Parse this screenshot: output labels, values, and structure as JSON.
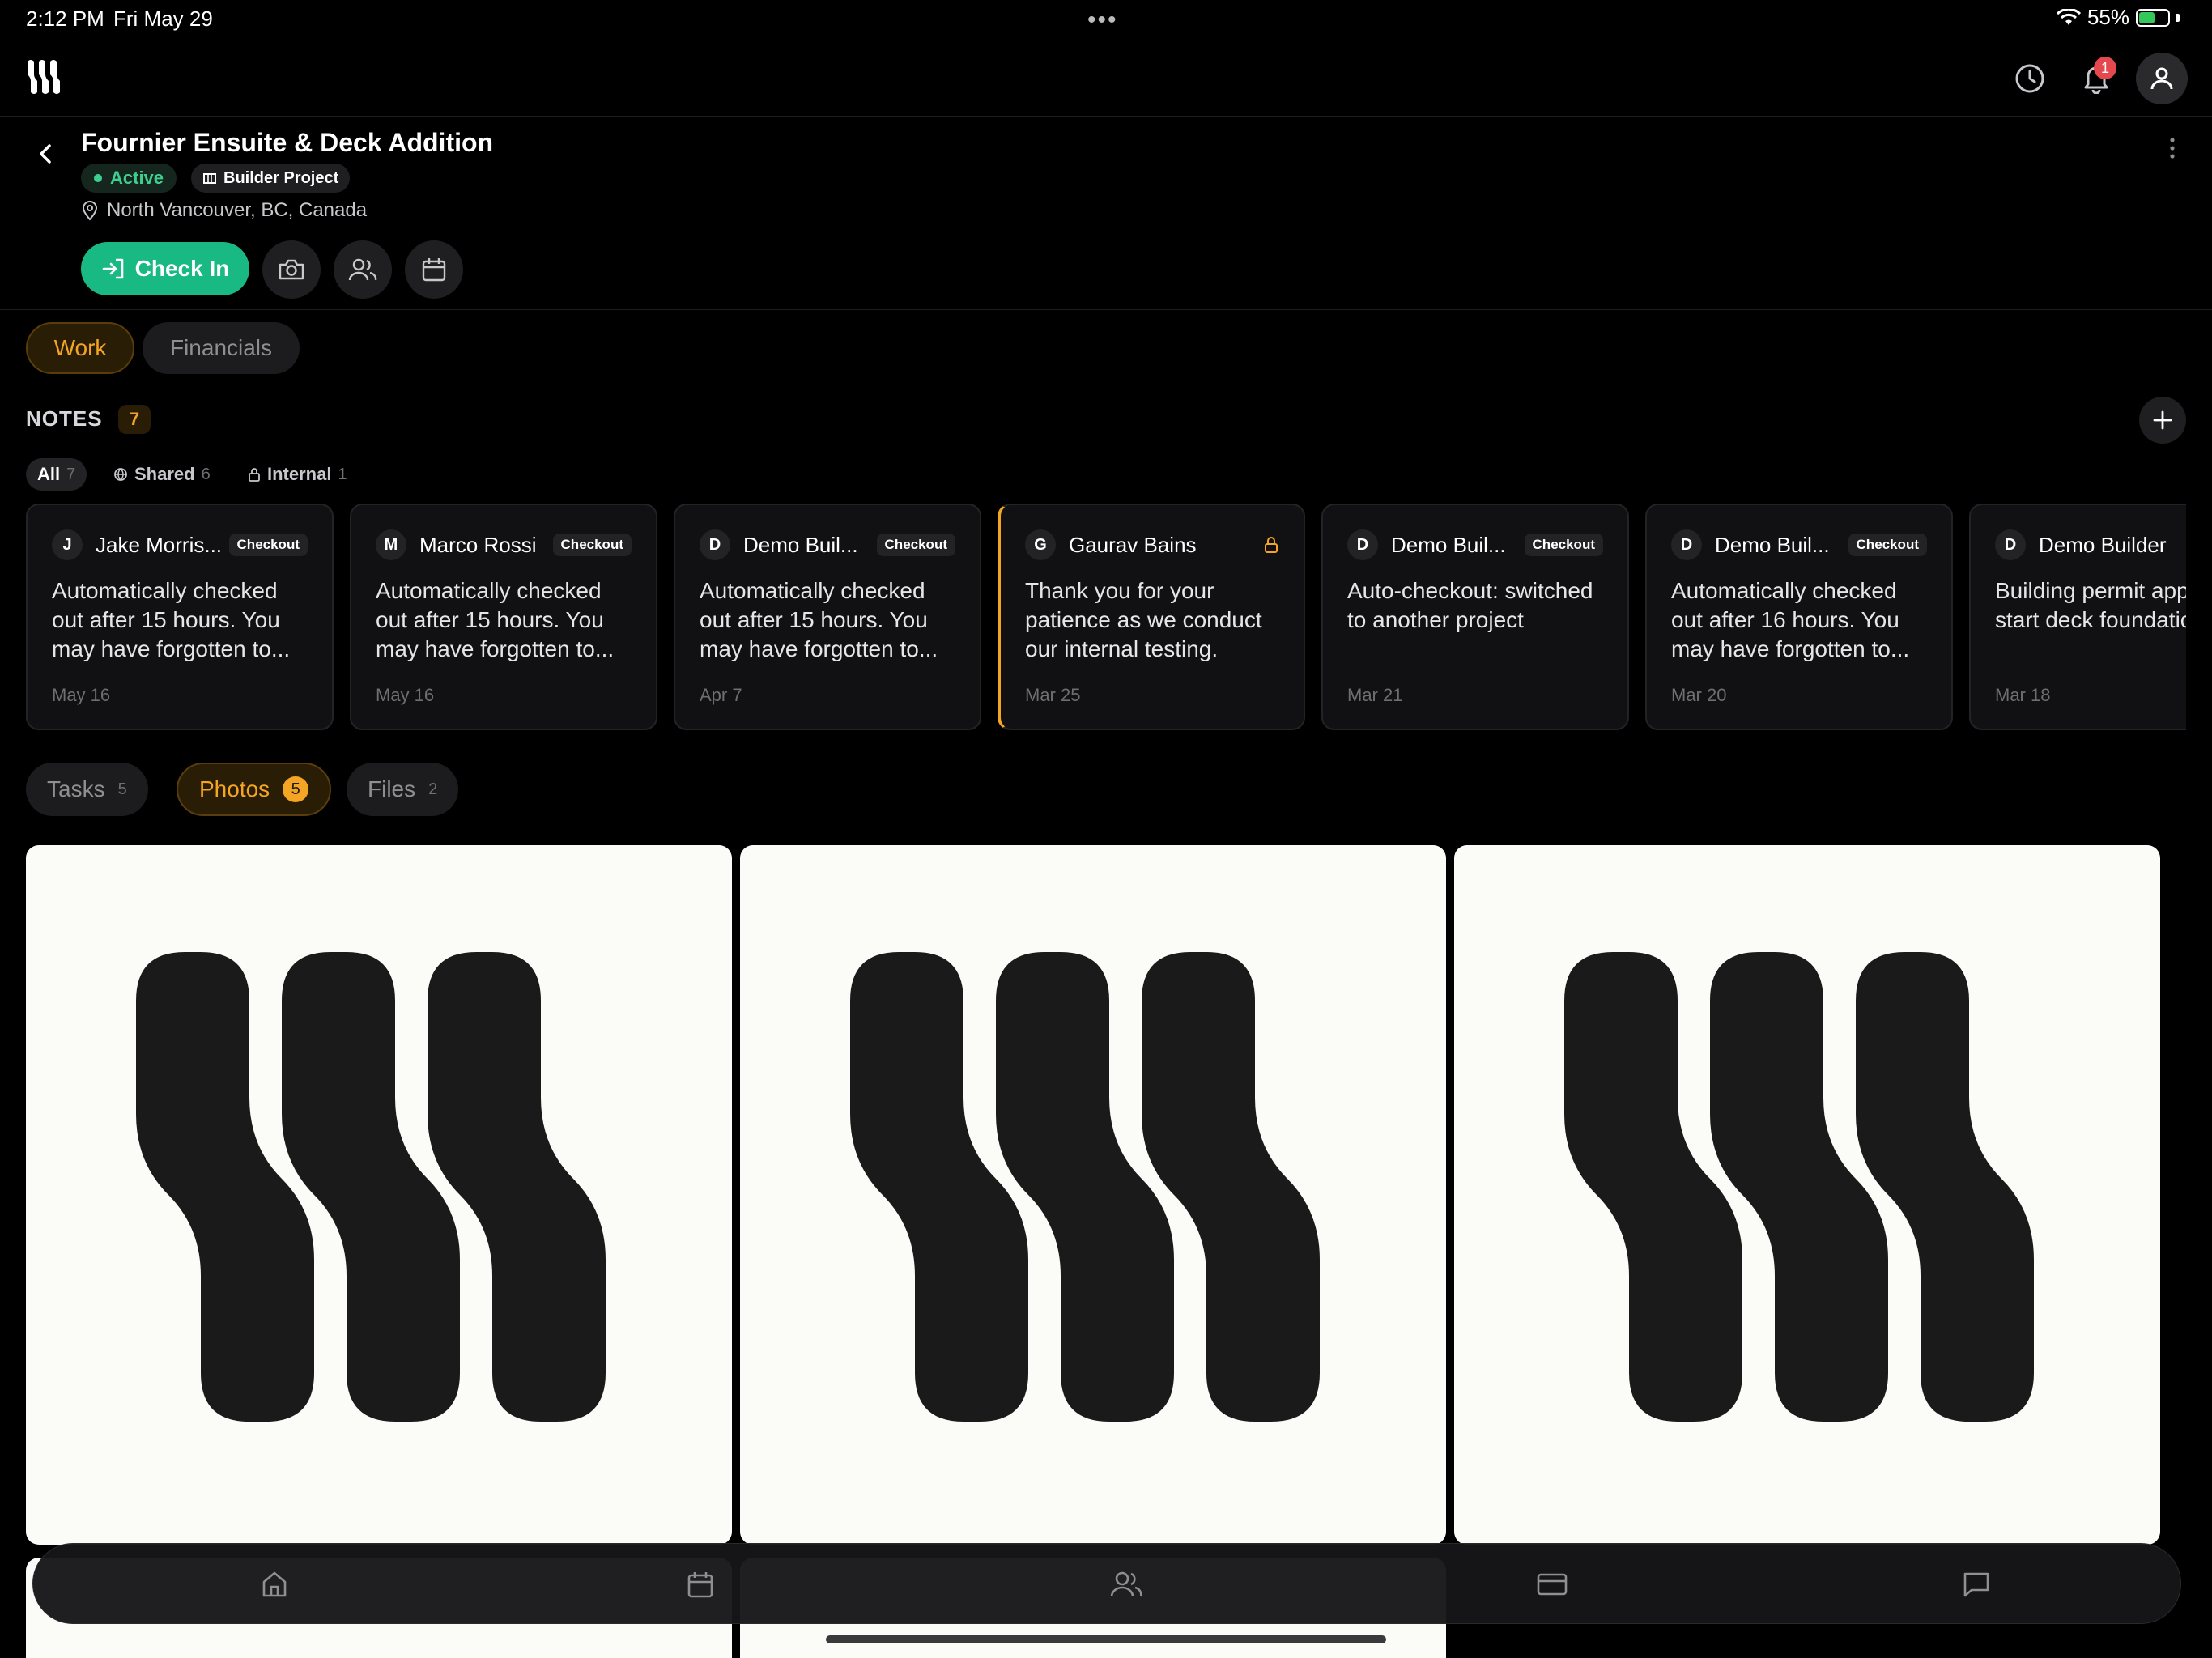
{
  "status_bar": {
    "time": "2:12 PM",
    "date": "Fri May 29",
    "battery": "55%",
    "battery_level": 0.55
  },
  "header": {
    "notification_count": "1"
  },
  "project": {
    "title": "Fournier Ensuite & Deck Addition",
    "status": "Active",
    "type": "Builder Project",
    "location": "North Vancouver, BC, Canada",
    "check_in_label": "Check In"
  },
  "main_tabs": [
    {
      "label": "Work",
      "active": true
    },
    {
      "label": "Financials",
      "active": false
    }
  ],
  "notes": {
    "title": "NOTES",
    "count": "7",
    "filters": [
      {
        "label": "All",
        "count": "7"
      },
      {
        "label": "Shared",
        "count": "6"
      },
      {
        "label": "Internal",
        "count": "1"
      }
    ],
    "items": [
      {
        "initial": "J",
        "author": "Jake Morris...",
        "tag": "Checkout",
        "body": "Automatically checked out after 15 hours. You may have forgotten to...",
        "date": "May 16"
      },
      {
        "initial": "M",
        "author": "Marco Rossi",
        "tag": "Checkout",
        "body": "Automatically checked out after 15 hours. You may have forgotten to...",
        "date": "May 16"
      },
      {
        "initial": "D",
        "author": "Demo Buil...",
        "tag": "Checkout",
        "body": "Automatically checked out after 15 hours. You may have forgotten to...",
        "date": "Apr 7"
      },
      {
        "initial": "G",
        "author": "Gaurav Bains",
        "tag": "",
        "body": "Thank you for your patience as we conduct our internal testing.",
        "date": "Mar 25"
      },
      {
        "initial": "D",
        "author": "Demo Buil...",
        "tag": "Checkout",
        "body": "Auto-checkout: switched to another project",
        "date": "Mar 21"
      },
      {
        "initial": "D",
        "author": "Demo Buil...",
        "tag": "Checkout",
        "body": "Automatically checked out after 16 hours. You may have forgotten to...",
        "date": "Mar 20"
      },
      {
        "initial": "D",
        "author": "Demo Builder",
        "tag": "",
        "body": "Building permit approved. Can start deck foundation n",
        "date": "Mar 18"
      }
    ]
  },
  "content_tabs": [
    {
      "label": "Tasks",
      "count": "5"
    },
    {
      "label": "Photos",
      "count": "5"
    },
    {
      "label": "Files",
      "count": "2"
    }
  ],
  "colors": {
    "accent": "#f5a524",
    "success": "#19b983",
    "background": "#000000"
  },
  "icons": {
    "nav": [
      "home-icon",
      "calendar-icon",
      "team-icon",
      "billing-icon",
      "messages-icon"
    ]
  }
}
